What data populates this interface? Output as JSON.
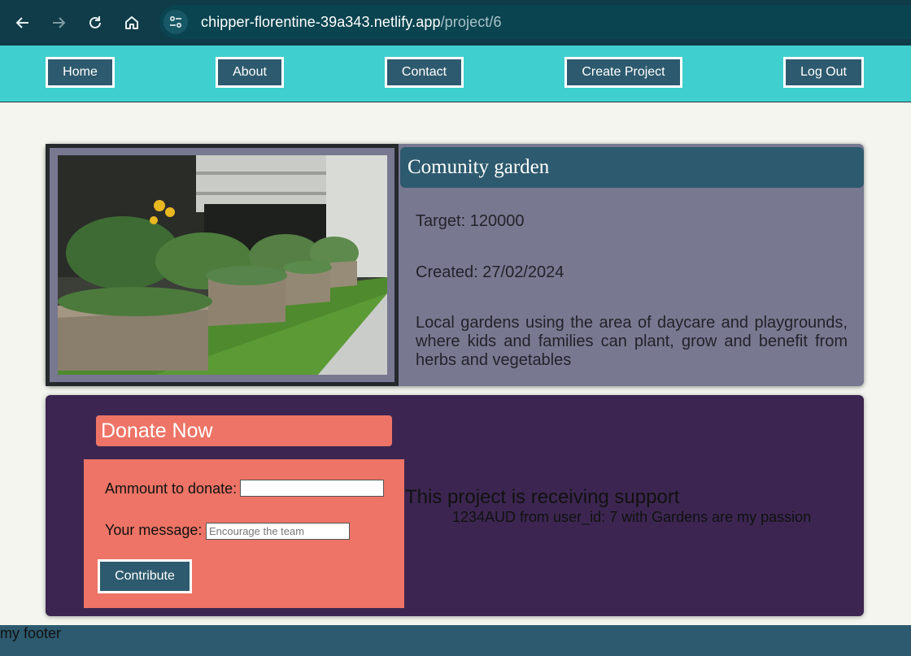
{
  "browser": {
    "url_host": "chipper-florentine-39a343.netlify.app",
    "url_path": "/project/6",
    "back_icon": "arrow-left-icon",
    "forward_icon": "arrow-right-icon",
    "reload_icon": "reload-icon",
    "home_icon": "home-icon",
    "site_info_icon": "tune-icon"
  },
  "nav": {
    "home": "Home",
    "about": "About",
    "contact": "Contact",
    "create_project": "Create Project",
    "logout": "Log Out"
  },
  "project": {
    "title": "Comunity garden",
    "target": "Target: 120000",
    "created": "Created: 27/02/2024",
    "description": "Local gardens using the area of daycare and playgrounds, where kids and families can plant, grow and benefit from herbs and vegetables"
  },
  "donate": {
    "title": "Donate Now",
    "amount_label": "Ammount to donate:",
    "amount_value": "",
    "message_label": "Your message:",
    "message_placeholder": "Encourage the team",
    "contribute_label": "Contribute"
  },
  "support": {
    "title": "This project is receiving support",
    "pledges": [
      "1234AUD from user_id: 7 with Gardens are my passion"
    ]
  },
  "footer": {
    "text": "my footer"
  },
  "colors": {
    "nav_bg": "#3fcfcf",
    "button_bg": "#2d5a6e",
    "card_bg": "#787891",
    "donate_bg": "#3c2651",
    "accent": "#ed7466"
  }
}
